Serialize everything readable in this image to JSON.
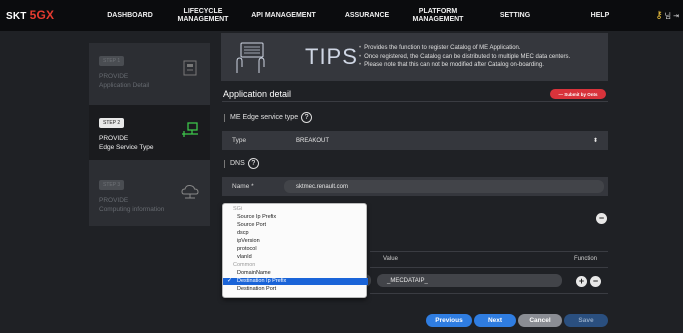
{
  "brand": {
    "left": "SKT",
    "mark": "5GX"
  },
  "nav": [
    {
      "label": "DASHBOARD"
    },
    {
      "label": "LIFECYCLE\nMANAGEMENT"
    },
    {
      "label": "API MANAGEMENT"
    },
    {
      "label": "ASSURANCE"
    },
    {
      "label": "PLATFORM\nMANAGEMENT"
    },
    {
      "label": "SETTING"
    },
    {
      "label": "HELP"
    }
  ],
  "user": {
    "name": "님"
  },
  "steps": [
    {
      "tag": "STEP 1",
      "line1": "PROVIDE",
      "line2": "Application Detail"
    },
    {
      "tag": "STEP 2",
      "line1": "PROVIDE",
      "line2": "Edge Service Type"
    },
    {
      "tag": "STEP 3",
      "line1": "PROVIDE",
      "line2": "Computing information"
    }
  ],
  "tips": {
    "word": "TIPS",
    "items": [
      "Provides the function to register Catalog of ME Application.",
      "Once registered, the Catalog can be distributed to multiple MEC data centers.",
      "Please note that this can not be modified after Catalog on-boarding."
    ]
  },
  "section": {
    "title": "Application detail",
    "submit_badge": "— Submit by Onts"
  },
  "edge_service": {
    "label": "ME Edge service type",
    "help": "?",
    "type_key": "Type",
    "type_value": "BREAKOUT"
  },
  "dns": {
    "label": "DNS",
    "help": "?",
    "name_key": "Name *",
    "name_value": "sktmec.renault.com"
  },
  "table": {
    "value_header": "Value",
    "function_header": "Function",
    "row_value": "_MECDATAIP_"
  },
  "dropdown": {
    "items": [
      {
        "label": "SGi",
        "group": true
      },
      {
        "label": "Source Ip Prefix"
      },
      {
        "label": "Source Port"
      },
      {
        "label": "dscp"
      },
      {
        "label": "ipVersion"
      },
      {
        "label": "protocol"
      },
      {
        "label": "vlanId"
      },
      {
        "label": "Common",
        "group": true
      },
      {
        "label": "DomainName"
      },
      {
        "label": "Destination Ip Prefix",
        "selected": true
      },
      {
        "label": "Destination Port"
      }
    ]
  },
  "buttons": {
    "previous": "Previous",
    "next": "Next",
    "cancel": "Cancel",
    "save": "Save"
  },
  "colors": {
    "accent": "#2f7de1",
    "danger": "#d8333b",
    "brand": "#e53b2f"
  }
}
